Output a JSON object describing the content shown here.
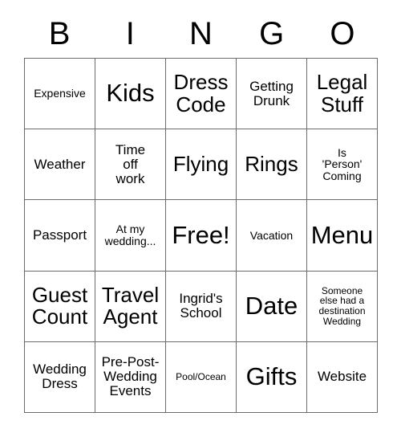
{
  "card": {
    "title_letters": [
      "B",
      "I",
      "N",
      "G",
      "O"
    ],
    "colors": {
      "text": "#000000",
      "grid_line": "#6b6b6b",
      "cell_background": "#ffffff",
      "page_background": "#ffffff"
    },
    "grid": {
      "columns": 5,
      "rows": 5,
      "free_space_index": 12
    },
    "cells": [
      {
        "text": "Expensive",
        "size": "sm"
      },
      {
        "text": "Kids",
        "size": "xxl"
      },
      {
        "text": "Dress\nCode",
        "size": "xl"
      },
      {
        "text": "Getting\nDrunk",
        "size": "md"
      },
      {
        "text": "Legal\nStuff",
        "size": "xl"
      },
      {
        "text": "Weather",
        "size": "md"
      },
      {
        "text": "Time\noff\nwork",
        "size": "md"
      },
      {
        "text": "Flying",
        "size": "xl"
      },
      {
        "text": "Rings",
        "size": "xl"
      },
      {
        "text": "Is\n'Person'\nComing",
        "size": "sm"
      },
      {
        "text": "Passport",
        "size": "md"
      },
      {
        "text": "At my\nwedding...",
        "size": "sm"
      },
      {
        "text": "Free!",
        "size": "xxl"
      },
      {
        "text": "Vacation",
        "size": "sm"
      },
      {
        "text": "Menu",
        "size": "xxl"
      },
      {
        "text": "Guest\nCount",
        "size": "xl"
      },
      {
        "text": "Travel\nAgent",
        "size": "xl"
      },
      {
        "text": "Ingrid's\nSchool",
        "size": "md"
      },
      {
        "text": "Date",
        "size": "xxl"
      },
      {
        "text": "Someone\nelse had a\ndestination\nWedding",
        "size": "xs"
      },
      {
        "text": "Wedding\nDress",
        "size": "md"
      },
      {
        "text": "Pre-Post-\nWedding\nEvents",
        "size": "md"
      },
      {
        "text": "Pool/Ocean",
        "size": "xs"
      },
      {
        "text": "Gifts",
        "size": "xxl"
      },
      {
        "text": "Website",
        "size": "md"
      }
    ]
  }
}
